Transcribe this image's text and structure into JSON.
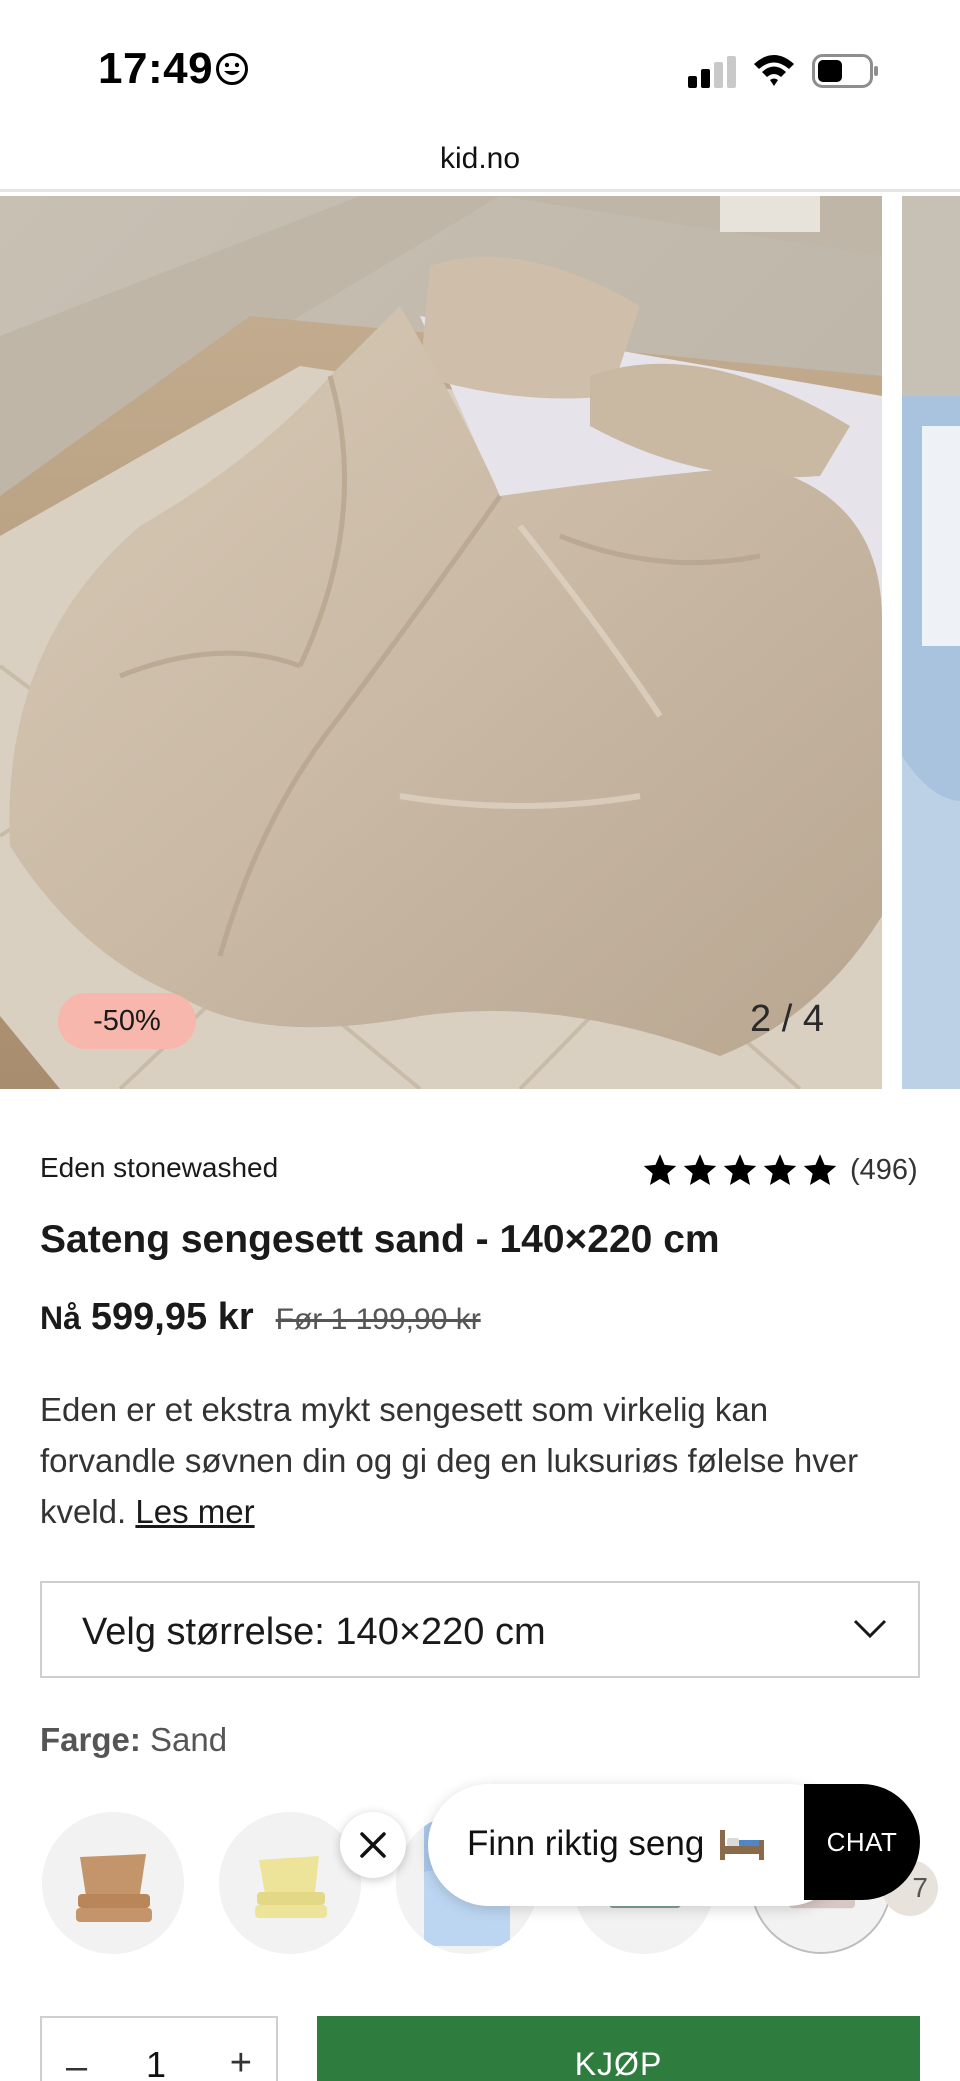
{
  "status_bar": {
    "time": "17:49"
  },
  "browser": {
    "url": "kid.no"
  },
  "gallery": {
    "discount_badge": "-50%",
    "counter": "2 / 4"
  },
  "product": {
    "brand": "Eden stonewashed",
    "rating_stars": 5,
    "review_count": "(496)",
    "title": "Sateng sengesett sand - 140×220 cm",
    "price_prefix": "Nå",
    "price_now": "599,95 kr",
    "price_before": "Før 1 199,90 kr",
    "description": "Eden er et ekstra mykt sengesett som virkelig kan forvandle søvnen din og gi deg en luksuriøs følelse hver kveld.",
    "read_more": "Les mer"
  },
  "size_select": {
    "label": "Velg størrelse: 140×220 cm"
  },
  "color": {
    "label": "Farge:",
    "value": "Sand",
    "swatches": [
      {
        "name": "caramel",
        "color": "#c4956a"
      },
      {
        "name": "yellow",
        "color": "#ede49a"
      },
      {
        "name": "light-blue",
        "color": "#a9c8ec"
      },
      {
        "name": "sage",
        "color": "#8fb0a6"
      },
      {
        "name": "blush",
        "color": "#e4d6d2"
      }
    ],
    "more_count": "7"
  },
  "popup": {
    "text": "Finn riktig seng",
    "chat_label": "CHAT"
  },
  "cart": {
    "minus": "–",
    "quantity": "1",
    "plus": "+",
    "buy_label": "KJØP"
  },
  "colors": {
    "discount_badge": "#f8b7ac",
    "buy_button": "#2e7d3e",
    "duvet": "#c9b9a5"
  }
}
